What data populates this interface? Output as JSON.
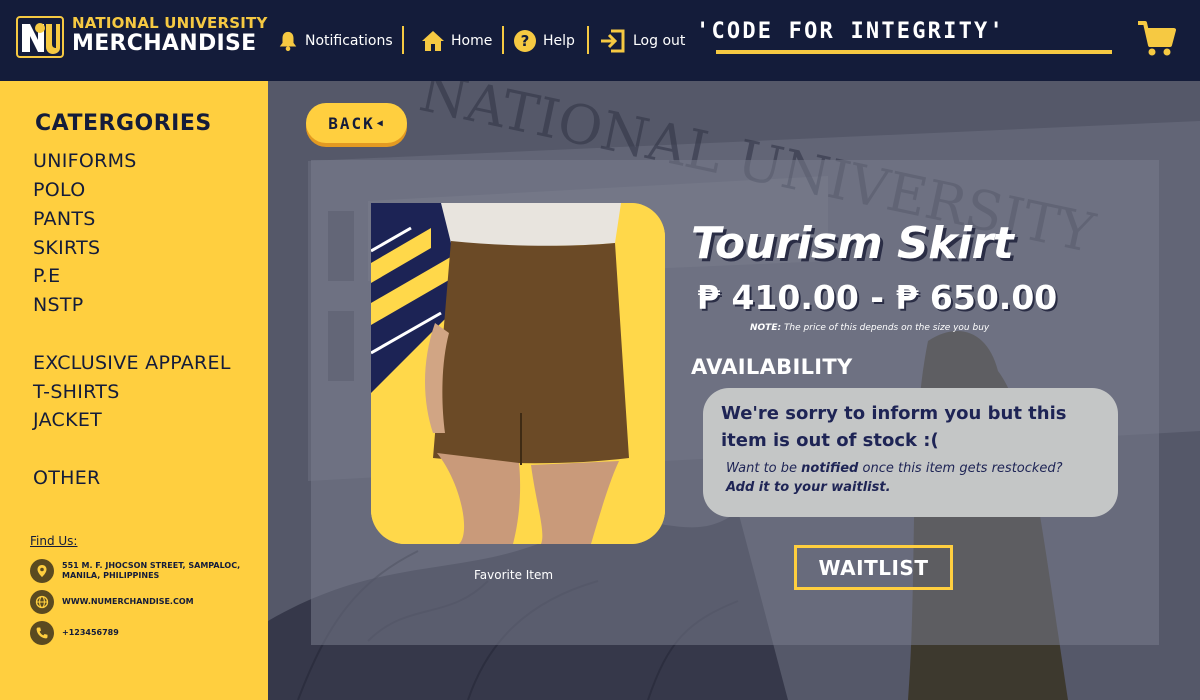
{
  "header": {
    "brand_top": "NATIONAL UNIVERSITY",
    "brand_bottom": "MERCHANDISE",
    "nav": {
      "notifications": "Notifications",
      "home": "Home",
      "help": "Help",
      "logout": "Log out"
    },
    "tagline": "'CODE FOR INTEGRITY'"
  },
  "sidebar": {
    "title": "CATERGORIES",
    "items": [
      "UNIFORMS",
      "POLO",
      "PANTS",
      "SKIRTS",
      "P.E",
      "NSTP",
      "EXCLUSIVE APPAREL",
      "T-SHIRTS",
      "JACKET",
      "OTHER"
    ],
    "find_us": "Find Us:",
    "contacts": {
      "address": "551 M. F. JHOCSON STREET, SAMPALOC, MANILA, PHILIPPINES",
      "website": "WWW.NUMERCHANDISE.COM",
      "phone": "+123456789"
    }
  },
  "main": {
    "back_label": "BACK",
    "product": {
      "name": "Tourism Skirt",
      "price": "₱ 410.00 - ₱ 650.00",
      "note_label": "NOTE:",
      "note_text": " The price of this depends on the size you buy",
      "image_caption": "Favorite Item"
    },
    "availability": {
      "label": "AVAILABILITY",
      "message": "We're sorry to inform you but this item is out of stock :(",
      "sub_1": "Want to be ",
      "sub_bold": "notified",
      "sub_2": " once this item gets restocked?",
      "sub_cta": "Add it to your waitlist."
    },
    "waitlist_label": "WAITLIST"
  },
  "colors": {
    "navy": "#141c3a",
    "gold": "#ffcf3f",
    "panel_box": "#c4c6c6"
  }
}
